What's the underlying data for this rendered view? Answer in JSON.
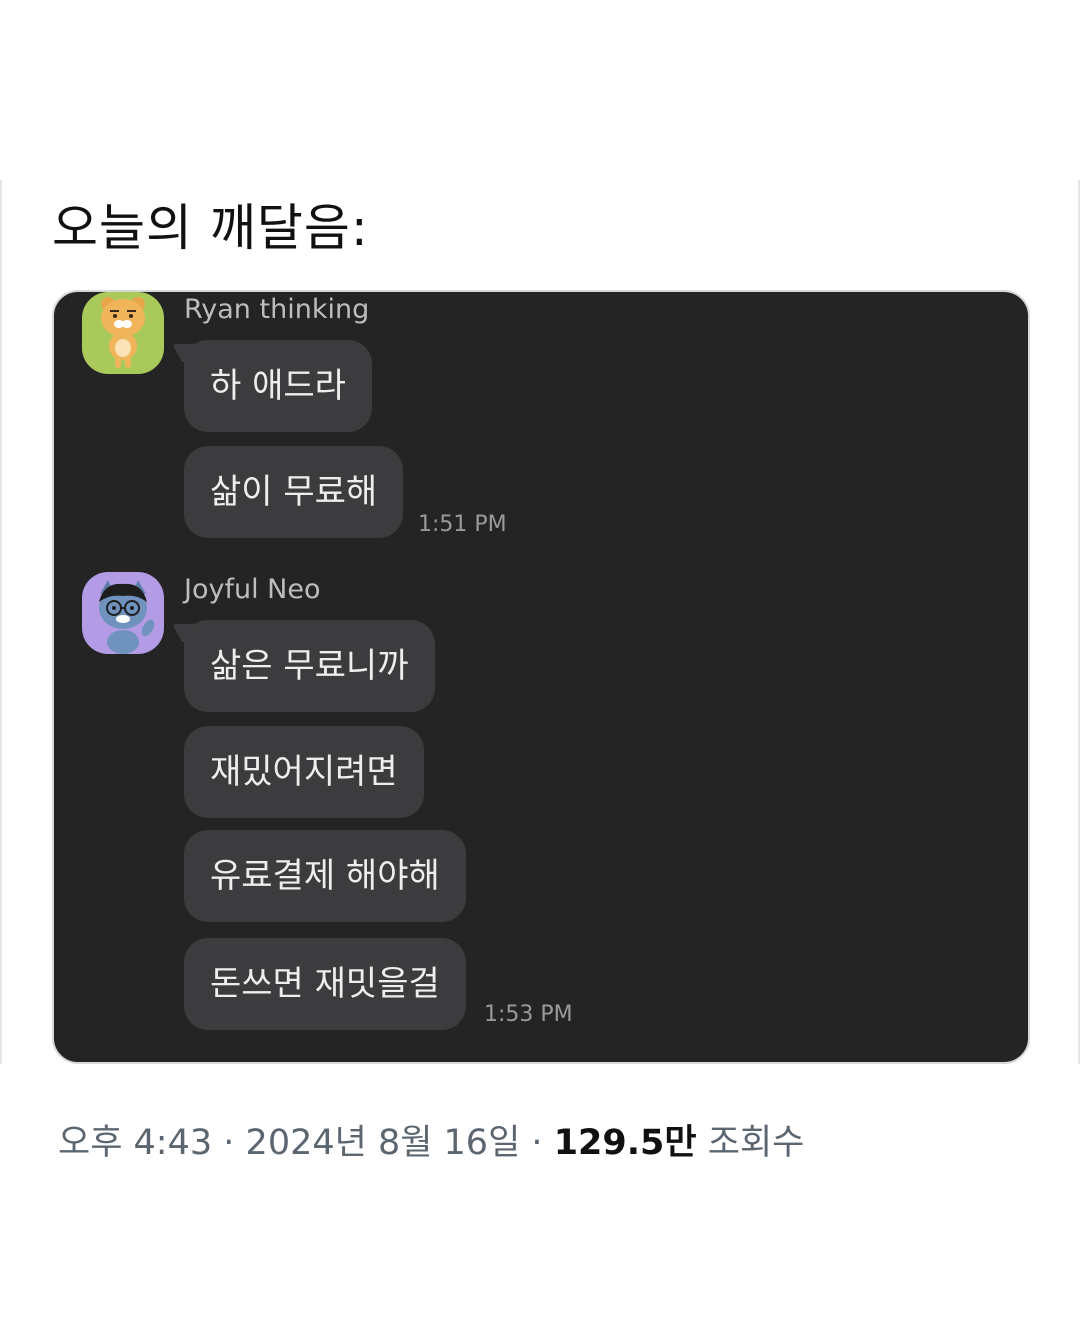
{
  "tweet": {
    "text": "오늘의 깨달음:",
    "meta": {
      "time": "오후 4:43",
      "separator": "·",
      "date": "2024년 8월 16일",
      "views_count": "129.5만",
      "views_label": "조회수"
    }
  },
  "chat": {
    "groups": [
      {
        "sender": "Ryan thinking",
        "avatar_icon": "ryan-character-icon",
        "avatar_bg": "#a9c95a",
        "messages": [
          "하 애드라",
          "삶이 무료해"
        ],
        "time": "1:51 PM"
      },
      {
        "sender": "Joyful Neo",
        "avatar_icon": "neo-character-icon",
        "avatar_bg": "#b49be6",
        "messages": [
          "삶은 무료니까",
          "재밌어지려면",
          "유료결제 해야해",
          "돈쓰면 재밋을걸"
        ],
        "time": "1:53 PM"
      }
    ]
  },
  "colors": {
    "chat_background": "#242425",
    "bubble": "#3c3c3e",
    "bubble_text": "#eeeeee",
    "meta_text": "#5b6670"
  }
}
